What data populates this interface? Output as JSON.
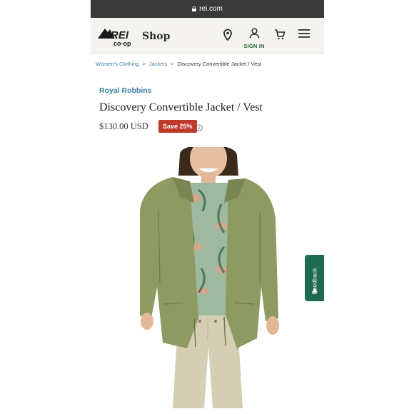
{
  "browser": {
    "url": "rei.com"
  },
  "header": {
    "shop_label": "Shop",
    "sign_in_label": "SIGN IN"
  },
  "breadcrumb": {
    "items": [
      "Women's Clothing",
      "Jackets",
      "Discovery Convertible Jacket / Vest"
    ],
    "separator": ">"
  },
  "product": {
    "brand": "Royal Robbins",
    "title": "Discovery Convertible Jacket / Vest",
    "price": "$130.00 USD",
    "save_badge": "Save 25%"
  },
  "feedback": {
    "label": "Feedback"
  },
  "colors": {
    "brand_green": "#2c6b36",
    "link_blue": "#3f7ea6",
    "save_red": "#c0392b",
    "feedback_green": "#1f6b4f"
  }
}
